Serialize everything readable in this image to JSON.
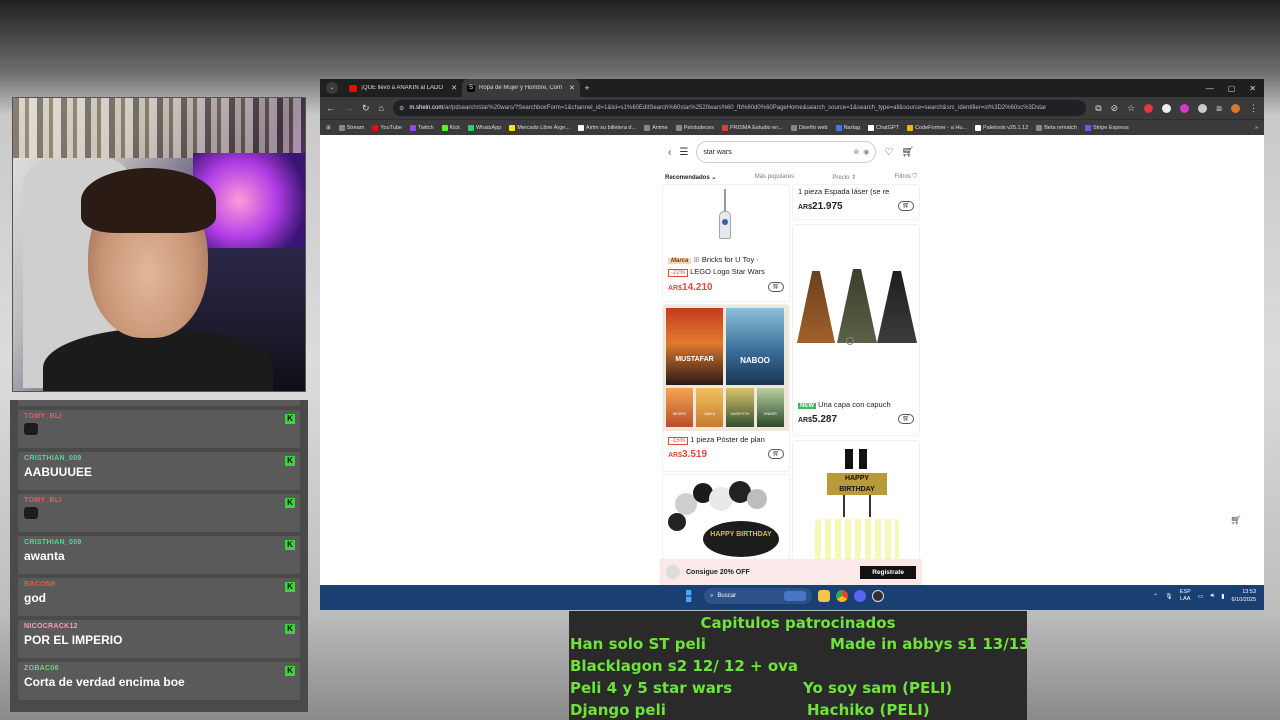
{
  "chat": {
    "messages": [
      {
        "user": "TOMY_BLI",
        "user_color": "#ff4d6a",
        "text": "",
        "emote": true
      },
      {
        "user": "CRISTHIAN_009",
        "user_color": "#53d89a",
        "text": "AABUUUEE",
        "emote": false
      },
      {
        "user": "TOMY_BLI",
        "user_color": "#ff4d6a",
        "text": "",
        "emote": true
      },
      {
        "user": "CRISTHIAN_009",
        "user_color": "#53d89a",
        "text": "awanta",
        "emote": false
      },
      {
        "user": "BACON8",
        "user_color": "#ff4d4d",
        "text": "god",
        "emote": false
      },
      {
        "user": "NICOCRACK12",
        "user_color": "#ff9ab4",
        "text": "POR EL IMPERIO",
        "emote": false
      },
      {
        "user": "ZOBAC06",
        "user_color": "#6fd66f",
        "text": "Corta de verdad encima boe",
        "emote": false
      }
    ],
    "badge_glyph": "K"
  },
  "browser": {
    "tabs": [
      {
        "title": "¡QUÉ llevó a ANAKIN al LADO",
        "favicon_color": "#ff0000",
        "active": false
      },
      {
        "title": "Ropa de Mujer y Hombre, Com",
        "favicon_color": "#ffffff",
        "favicon_glyph": "S",
        "active": true
      }
    ],
    "url_host": "m.shein.com",
    "url_path": "/ar/pdsearch/star%20wars/?SearchboxForm=1&channel_id=1&ici=s1%60EditSearch%60star%2520wars%60_fb%60d0%60PageHome&search_source=1&search_type=all&source=search&src_identifier=st%3D2%60sc%3Dstar",
    "bookmarks": [
      {
        "label": "Stream",
        "color": "#888888"
      },
      {
        "label": "YouTube",
        "color": "#ff0000"
      },
      {
        "label": "Twitch",
        "color": "#9146ff"
      },
      {
        "label": "Kick",
        "color": "#53fc18"
      },
      {
        "label": "WhatsApp",
        "color": "#25d366"
      },
      {
        "label": "Mercado Libre Arge...",
        "color": "#ffe600"
      },
      {
        "label": "Airtm su billetera d...",
        "color": "#ffffff"
      },
      {
        "label": "Anime",
        "color": "#888888"
      },
      {
        "label": "Pelotudeces",
        "color": "#888888"
      },
      {
        "label": "PRISMA Estudio en...",
        "color": "#e23b3b"
      },
      {
        "label": "Diseño web",
        "color": "#888888"
      },
      {
        "label": "Nartag",
        "color": "#3b7be2"
      },
      {
        "label": "ChatGPT",
        "color": "#ffffff"
      },
      {
        "label": "CodeFormer - a Hu...",
        "color": "#f2b600"
      },
      {
        "label": "Paletools v25.1.12",
        "color": "#ffffff"
      },
      {
        "label": "Beta rematch",
        "color": "#888888"
      },
      {
        "label": "Stripe Express",
        "color": "#635bff"
      }
    ]
  },
  "shop": {
    "search_query": "star wars",
    "sort": {
      "recommended": "Recomendados",
      "popular": "Más populares",
      "price": "Precio",
      "filters": "Filtros"
    },
    "products": [
      {
        "brand": "Marca",
        "store": "Bricks for U Toy",
        "discount": "-22%",
        "name": "LEGO Logo Star Wars",
        "currency": "AR$",
        "price": "14.210"
      },
      {
        "discount": "-15%",
        "name": "1 pieza Póster de plan",
        "currency": "AR$",
        "price": "3.519",
        "posters": [
          "MUSTAFAR",
          "NABOO",
          "BESPIN",
          "JAKKU",
          "KASHYYYK",
          "ENDOR"
        ]
      },
      {
        "name": "1 pieza Espada láser (se re",
        "currency": "AR$",
        "price": "21.975"
      },
      {
        "badge": "NEW",
        "name": "Una capa con capuch",
        "currency": "AR$",
        "price": "5.287"
      },
      {
        "cake_text": "HAPPY BIRTHDAY"
      },
      {
        "cake_text": "HAPPY BIRTHDAY"
      }
    ],
    "bottom_bar": {
      "text": "Consigue 20% OFF",
      "button": "Regístrate"
    }
  },
  "taskbar": {
    "search_placeholder": "Buscar",
    "lang": "ESP",
    "lang_sub": "LAA",
    "time": "13:53",
    "date": "6/10/2025"
  },
  "notes": {
    "title": "Capitulos patrocinados",
    "left": [
      "Han solo ST peli",
      "Blacklagon s2 12/ 12 + ova",
      "Peli 4  y 5 star wars",
      "Django peli"
    ],
    "right": [
      "Made in abbys s1 13/13",
      "",
      "Yo soy sam (PELI)",
      "Hachiko (PELI)"
    ]
  }
}
